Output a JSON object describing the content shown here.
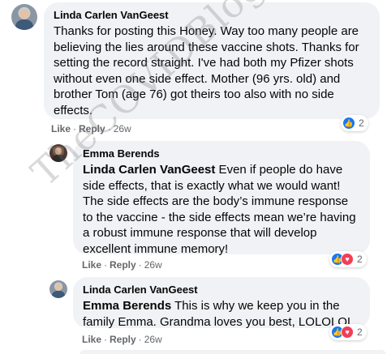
{
  "comments": [
    {
      "author": "Linda Carlen VanGeest",
      "mention": "",
      "text": "Thanks for posting this Honey. Way too many people are believing the lies around these vaccine shots. Thanks for setting the record straight. I've had both my Pfizer shots without even one side effect. Mother (96 yrs. old) and brother Tom (age 76) got theirs too also with no side effects.",
      "like_label": "Like",
      "reply_label": "Reply",
      "separator": "·",
      "time": "26w",
      "reaction_count": "2",
      "reactions": [
        "like-icon"
      ]
    },
    {
      "author": "Emma Berends",
      "mention": "Linda Carlen VanGeest",
      "text": " Even if people do have side effects, that is exactly what we would want! The side effects are the body’s immune response to the vaccine - the side effects mean we’re having a robust immune response that will develop excellent immune memory!",
      "like_label": "Like",
      "reply_label": "Reply",
      "separator": "·",
      "time": "26w",
      "reaction_count": "2",
      "reactions": [
        "like-icon",
        "love-icon"
      ]
    },
    {
      "author": "Linda Carlen VanGeest",
      "mention": "Emma Berends",
      "text": " This is why we keep you in the family Emma. Grandma loves you best, LOLOLOL",
      "like_label": "Like",
      "reply_label": "Reply",
      "separator": "·",
      "time": "26w",
      "reaction_count": "2",
      "reactions": [
        "like-icon",
        "love-icon"
      ]
    }
  ],
  "watermark": "TheCOVIDBlog.com",
  "colors": {
    "bubble": "#f0f2f5",
    "meta": "#65676b",
    "like": "#1877f2",
    "love": "#f33e58"
  }
}
